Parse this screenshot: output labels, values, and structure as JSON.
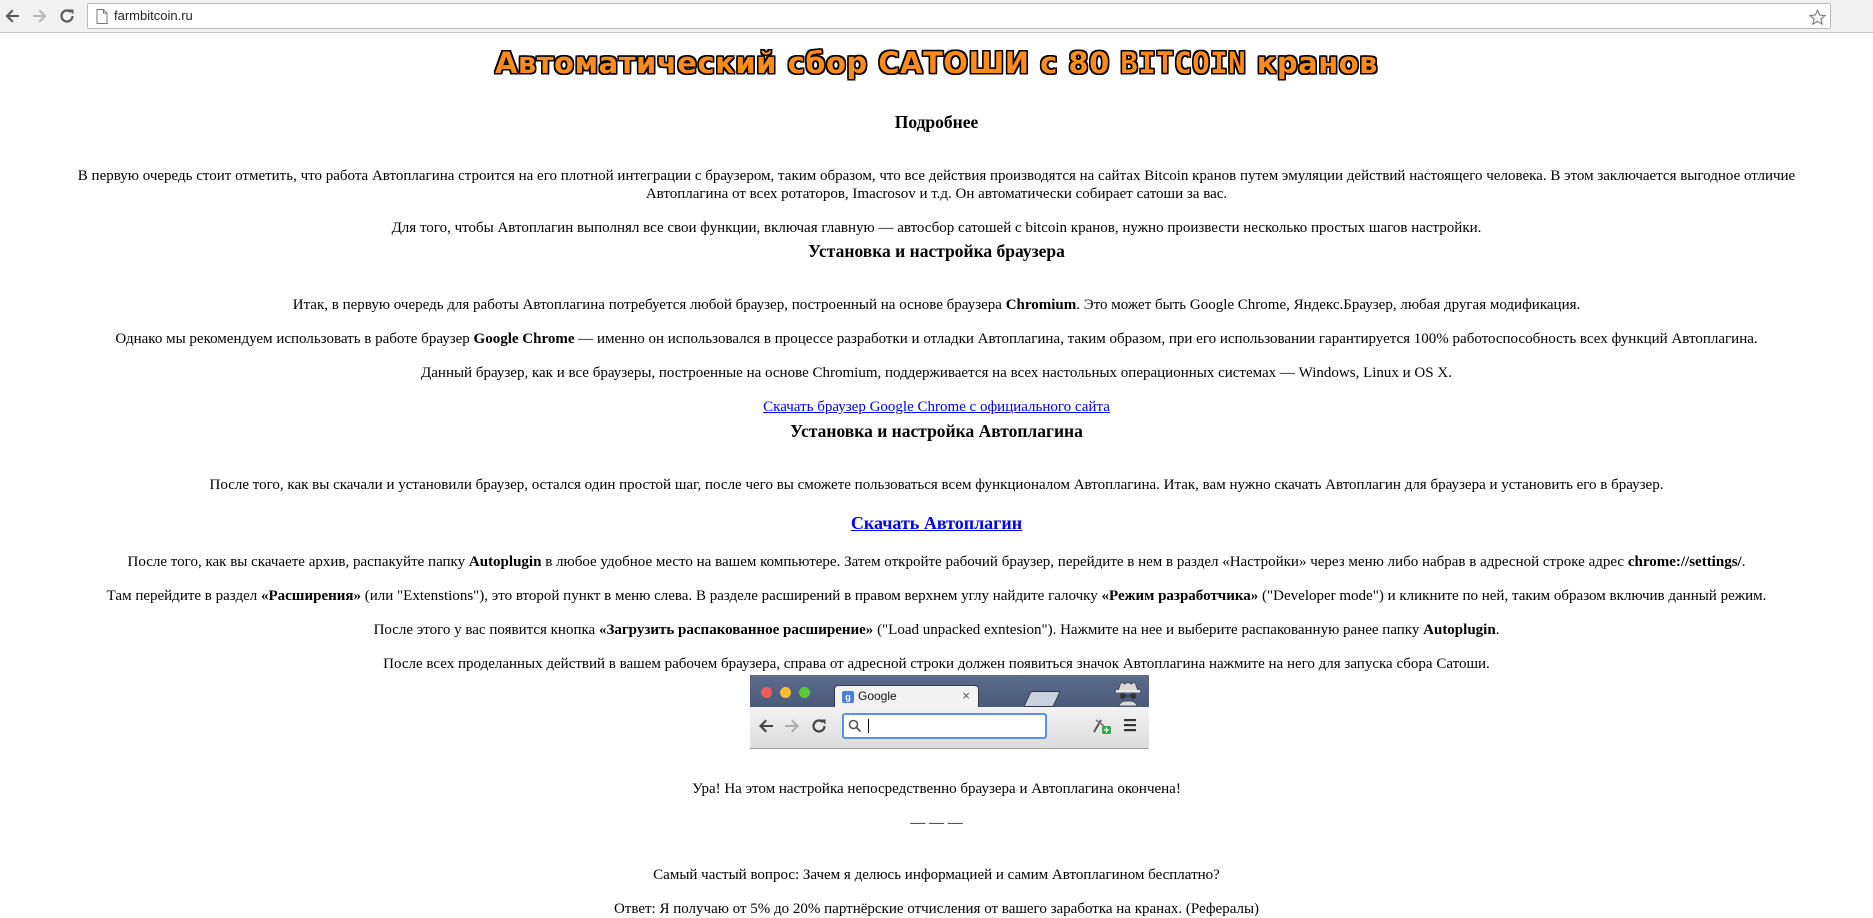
{
  "browser": {
    "url": "farmbitcoin.ru"
  },
  "page": {
    "headline": {
      "pre": "Автоматический сбор САТОШИ с 80 ",
      "bitcoin": "BITCOIN",
      "post": " кранов"
    },
    "section1_title": "Подробнее",
    "p1_line1": "В первую очередь стоит отметить, что работа Автоплагина строится на его плотной интеграции с браузером, таким образом, что все действия производятся на сайтах Bitcoin кранов путем эмуляции действий настоящего человека. В этом заключается выгодное отличие",
    "p1_line2": "Автоплагина от всех ротаторов, Imacrosov и т.д. Он автоматически собирает сатоши за вас.",
    "p2": "Для того, чтобы Автоплагин выполнял все свои функции, включая главную — автосбор сатошей с bitcoin кранов, нужно произвести несколько простых шагов настройки.",
    "section2_title": "Установка и настройка браузера",
    "p3": {
      "a": "Итак, в первую очередь для работы Автоплагина потребуется любой браузер, построенный на основе браузера ",
      "b": "Chromium",
      "c": ". Это может быть Google Chrome, Яндекс.Браузер, любая другая модификация."
    },
    "p4": {
      "a": "Однако мы рекомендуем использовать в работе браузер ",
      "b": "Google Chrome",
      "c": " — именно он использовался в процессе разработки и отладки Автоплагина, таким образом, при его использовании гарантируется 100% работоспособность всех функций Автоплагина."
    },
    "p5": "Данный браузер, как и все браузеры, построенные на основе Chromium, поддерживается на всех настольных операционных системах — Windows, Linux и OS X.",
    "link_chrome": "Скачать браузер Google Chrome с официального сайта",
    "section3_title": "Установка и настройка Автоплагина",
    "p6": "После того, как вы скачали и установили браузер, остался один простой шаг, после чего вы сможете пользоваться всем функционалом Автоплагина. Итак, вам нужно скачать Автоплагин для браузера и установить его в браузер.",
    "link_plugin": "Скачать Автоплагин",
    "p7": {
      "a": "После того, как вы скачаете архив, распакуйте папку ",
      "b": "Autoplugin",
      "c": " в любое удобное место на вашем компьютере. Затем откройте рабочий браузер, перейдите в нем в раздел «Настройки» через меню либо набрав в адресной строке адрес ",
      "d": "chrome://settings/",
      "e": "."
    },
    "p8": {
      "a": "Там перейдите в раздел ",
      "b": "«Расширения»",
      "c": " (или \"Extenstions\"), это второй пункт в меню слева. В разделе расширений в правом верхнем углу найдите галочку ",
      "d": "«Режим разработчика»",
      "e": " (\"Developer mode\") и кликните по ней, таким образом включив данный режим."
    },
    "p9": {
      "a": "После этого у вас появится кнопка ",
      "b": "«Загрузить распакованное расширение»",
      "c": " (\"Load unpacked exntesion\"). Нажмите на нее и выберите распакованную ранее папку ",
      "d": "Autoplugin",
      "e": "."
    },
    "p10": "После всех проделанных действий в вашем рабочем браузера, справа от адресной строки должен появиться значок Автоплагина нажмите на него для запуска сбора Сатоши.",
    "image_tab_title": "Google",
    "image_tab_close": "×",
    "image_favicon": "g",
    "p11": "Ура! На этом настройка непосредственно браузера и Автоплагина окончена!",
    "separator": "— — —",
    "p12": "Самый частый вопрос: Зачем я делюсь информацией и самим Автоплагином бесплатно?",
    "p13": "Ответ: Я получаю от 5% до 20% партнёрские отчисления от вашего заработка на кранах. (Рефералы)"
  }
}
